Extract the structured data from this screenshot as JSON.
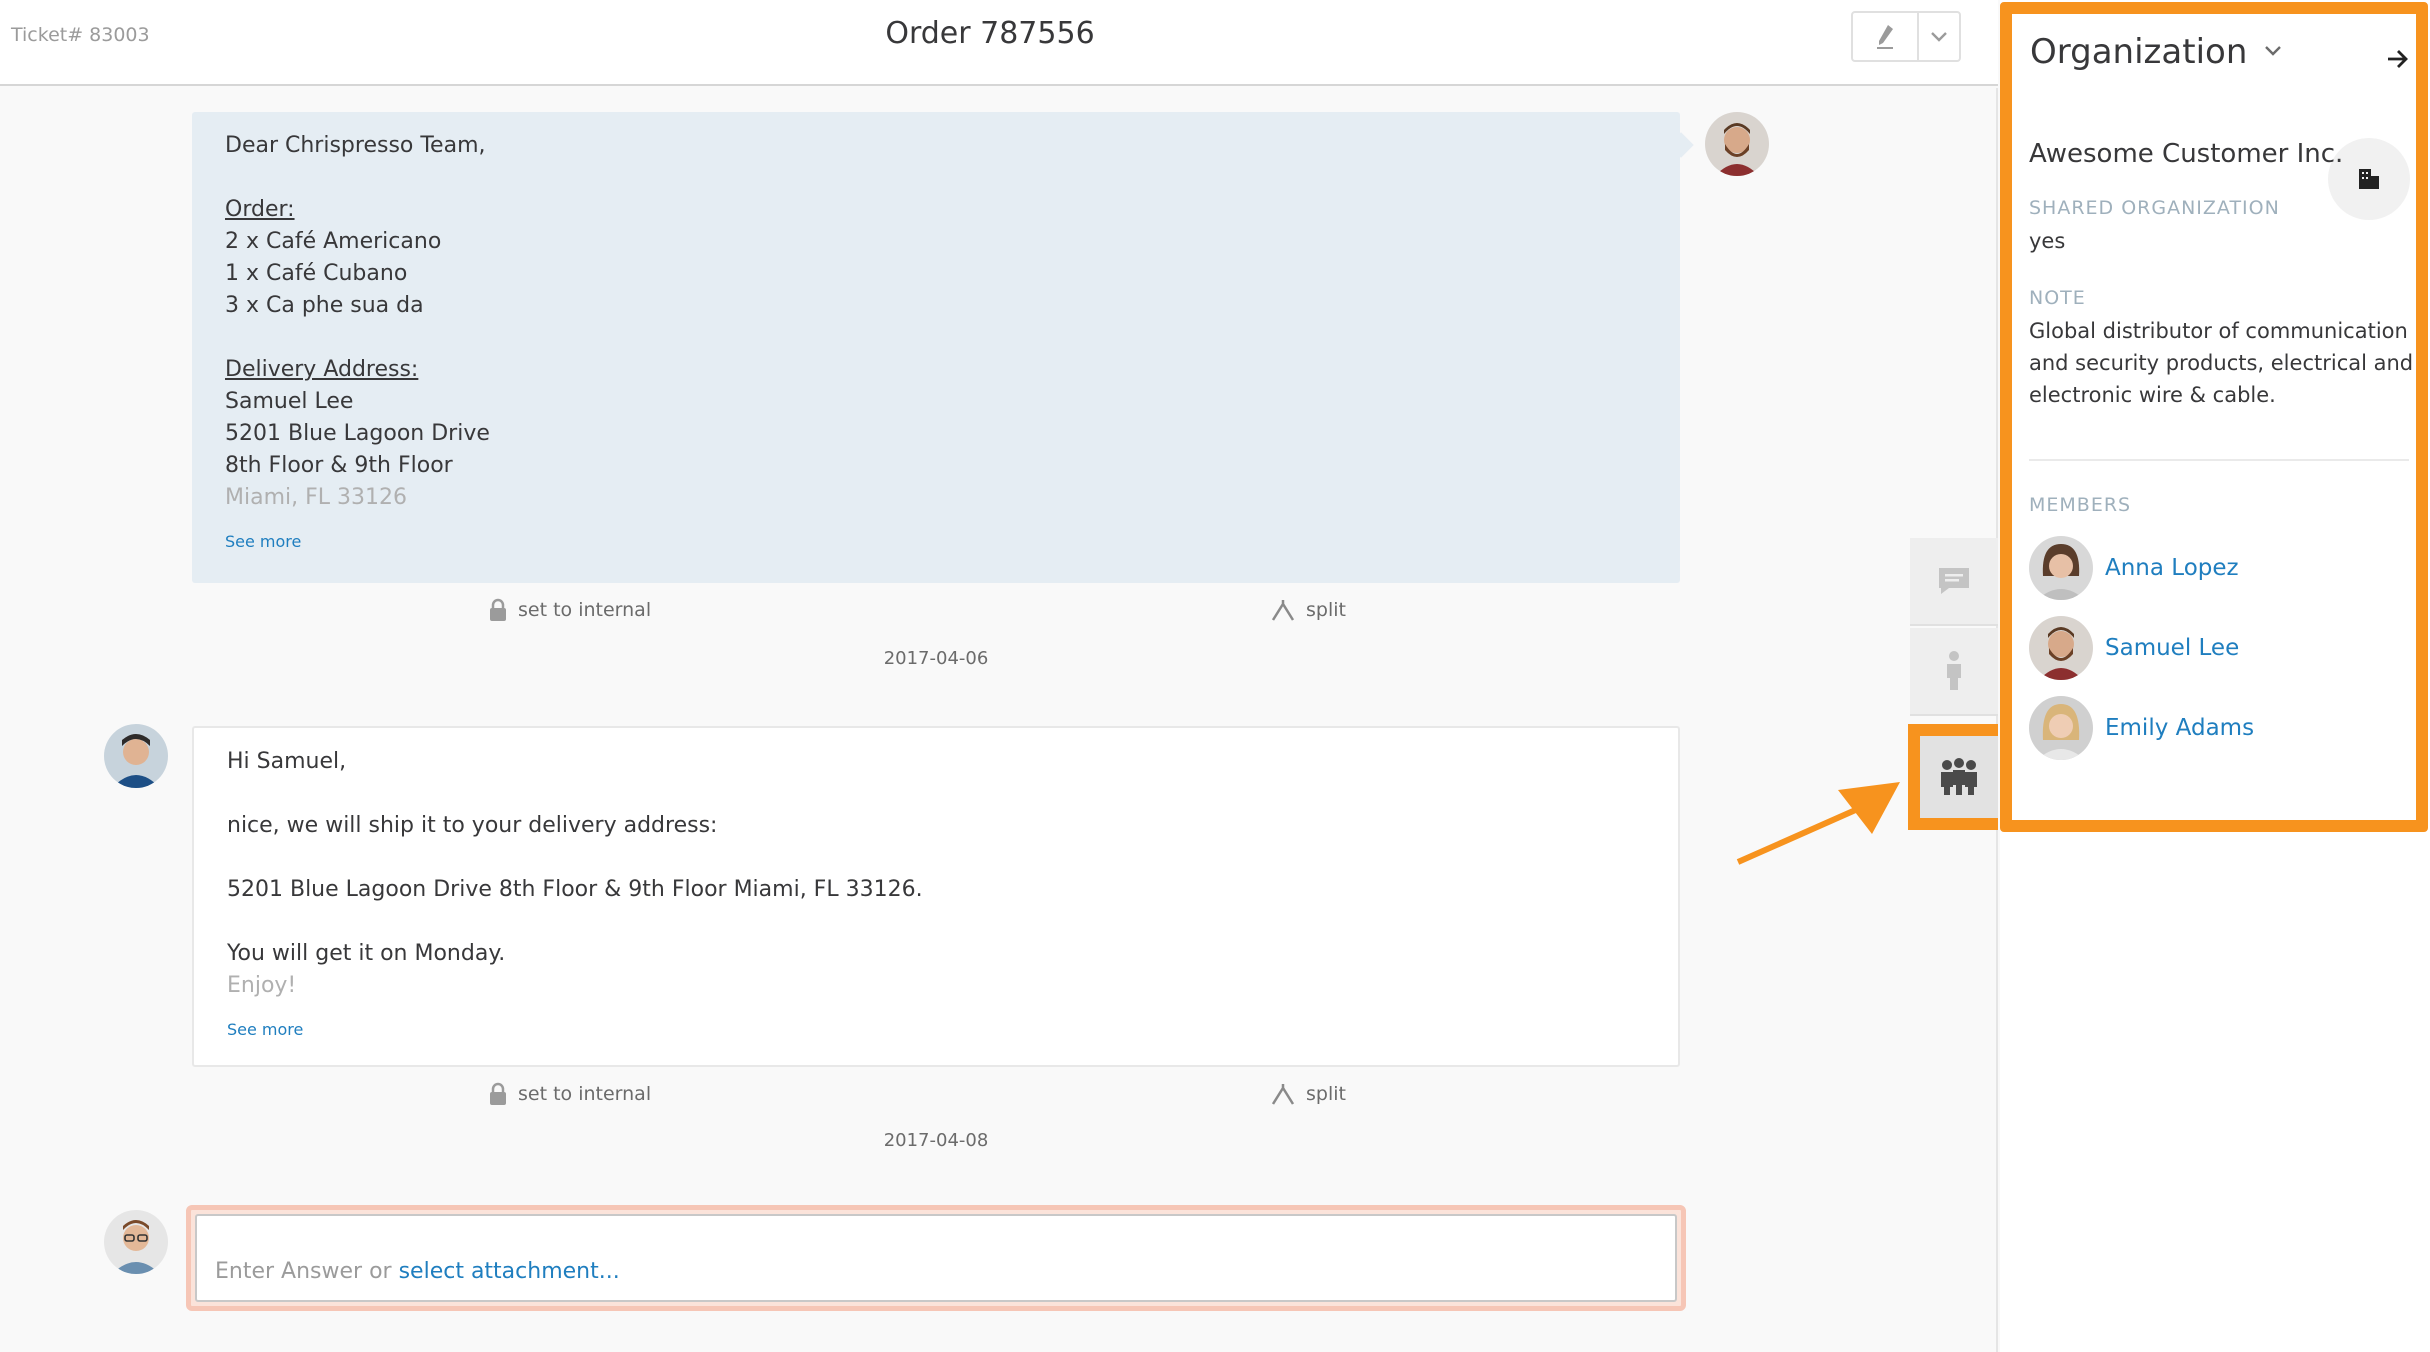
{
  "header": {
    "ticket_number": "Ticket# 83003",
    "title": "Order 787556"
  },
  "articles": [
    {
      "greeting": "Dear Chrispresso Team,",
      "order_heading": "Order:",
      "order_lines": [
        "2 x Café Americano",
        "1 x Café Cubano",
        "3 x Ca phe sua da"
      ],
      "address_heading": "Delivery Address:",
      "address_lines": [
        "Samuel Lee",
        "5201 Blue Lagoon Drive",
        "8th Floor & 9th Floor"
      ],
      "address_faded": "Miami, FL 33126",
      "see_more": "See more",
      "action_internal": "set to internal",
      "action_split": "split",
      "date": "2017-04-06"
    },
    {
      "greeting": "Hi Samuel,",
      "line1": "nice, we will ship it to your delivery address:",
      "line2": "5201 Blue Lagoon Drive 8th Floor & 9th Floor Miami, FL 33126.",
      "line3": "You will get it on Monday.",
      "line_faded": "Enjoy!",
      "see_more": "See more",
      "action_internal": "set to internal",
      "action_split": "split",
      "date": "2017-04-08"
    }
  ],
  "reply": {
    "placeholder": "Enter Answer or",
    "attach_link": "select attachment..."
  },
  "sidebar_tabs": [
    "chat-icon",
    "person-icon",
    "organization-icon"
  ],
  "organization": {
    "heading": "Organization",
    "name": "Awesome Customer Inc.",
    "shared_label": "SHARED ORGANIZATION",
    "shared_value": "yes",
    "note_label": "NOTE",
    "note_value": "Global distributor of communication and security products, electrical and electronic wire & cable.",
    "members_label": "MEMBERS",
    "members": [
      "Anna Lopez",
      "Samuel Lee",
      "Emily Adams"
    ]
  },
  "colors": {
    "highlight": "#f7931e",
    "link": "#1f7ebf",
    "customer_bubble": "#e5edf3"
  }
}
